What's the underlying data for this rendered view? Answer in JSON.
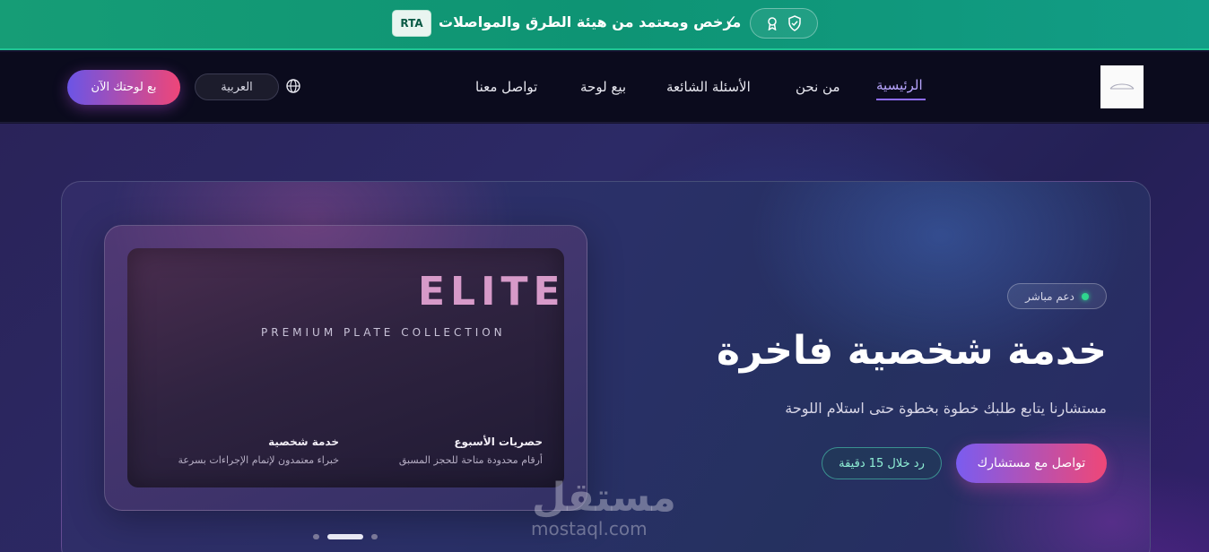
{
  "banner": {
    "rta_label": "RTA",
    "text": "مرخص ومعتمد من هيئة الطرق والمواصلات",
    "check": "✓"
  },
  "nav": {
    "links": [
      {
        "label": "الرئيسية",
        "active": true
      },
      {
        "label": "من نحن"
      },
      {
        "label": "الأسئلة الشائعة"
      },
      {
        "label": "بيع لوحة"
      },
      {
        "label": "تواصل معنا"
      }
    ],
    "language_button": "العربية",
    "cta_label": "بع لوحتك الآن"
  },
  "plate_card": {
    "brand": "ELITE",
    "tagline": "PREMIUM PLATE COLLECTION",
    "features": [
      {
        "title": "حصريات الأسبوع",
        "desc": "أرقام محدودة متاحة للحجز المسبق"
      },
      {
        "title": "خدمة شخصية",
        "desc": "خبراء معتمدون لإتمام الإجراءات بسرعة"
      }
    ]
  },
  "hero": {
    "support_badge": "دعم مباشر",
    "title": "خدمة شخصية فاخرة",
    "subtitle": "مستشارنا يتابع طلبك خطوة بخطوة حتى استلام اللوحة",
    "primary_cta": "تواصل مع مستشارك",
    "secondary_badge": "رد خلال 15 دقيقة"
  },
  "carousel": {
    "active_index": 1,
    "count": 3
  },
  "watermark": {
    "arabic": "مستقل",
    "latin": "mostaql.com"
  },
  "colors": {
    "banner_green": "#0e9474",
    "accent_purple": "#7a5cf0",
    "accent_pink": "#ef4777",
    "elite_pink": "#d79ac9",
    "live_green": "#2fd58e"
  },
  "icons": {
    "banner": [
      "shield-check-icon",
      "award-ribbon-icon"
    ],
    "nav": [
      "globe-icon"
    ]
  }
}
